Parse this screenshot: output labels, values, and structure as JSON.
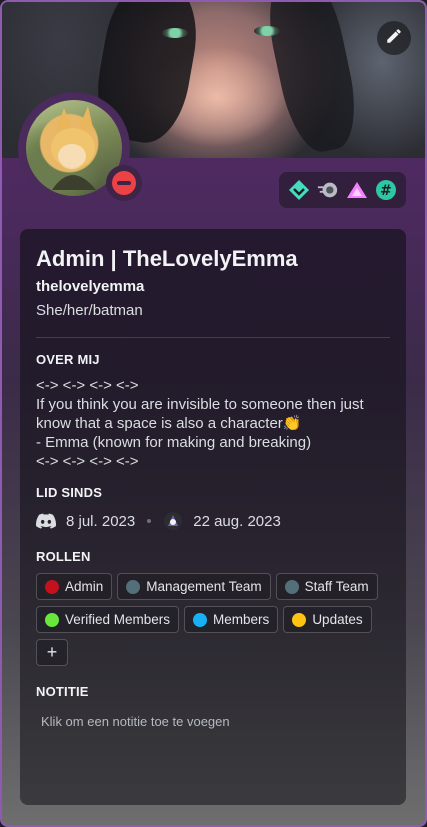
{
  "profile": {
    "display_name": "Admin | TheLovelyEmma",
    "username": "thelovelyemma",
    "pronouns": "She/her/batman",
    "status": "do-not-disturb"
  },
  "about": {
    "title": "OVER MIJ",
    "lines": [
      "<-> <-> <-> <->",
      "If you think you are invisible to someone then just know that a space is also a character👏",
      "- Emma (known for making and breaking)",
      "<-> <-> <-> <->"
    ]
  },
  "member_since": {
    "title": "LID SINDS",
    "discord_date": "8 jul. 2023",
    "server_date": "22 aug. 2023"
  },
  "roles": {
    "title": "ROLLEN",
    "items": [
      {
        "label": "Admin",
        "color": "#c4111b"
      },
      {
        "label": "Management Team",
        "color": "#546e7a"
      },
      {
        "label": "Staff Team",
        "color": "#546e7a"
      },
      {
        "label": "Verified Members",
        "color": "#67e83b"
      },
      {
        "label": "Members",
        "color": "#17b1f4"
      },
      {
        "label": "Updates",
        "color": "#ffc312"
      }
    ],
    "add_label": "+"
  },
  "note": {
    "title": "NOTITIE",
    "placeholder": "Klik om een notitie toe te voegen"
  },
  "badges": [
    "hypesquad-balance-icon",
    "nitro-boost-icon",
    "triangle-badge-icon",
    "hashtag-badge-icon"
  ],
  "icons": {
    "edit": "pencil-icon",
    "discord": "discord-logo-icon",
    "server": "server-icon"
  }
}
